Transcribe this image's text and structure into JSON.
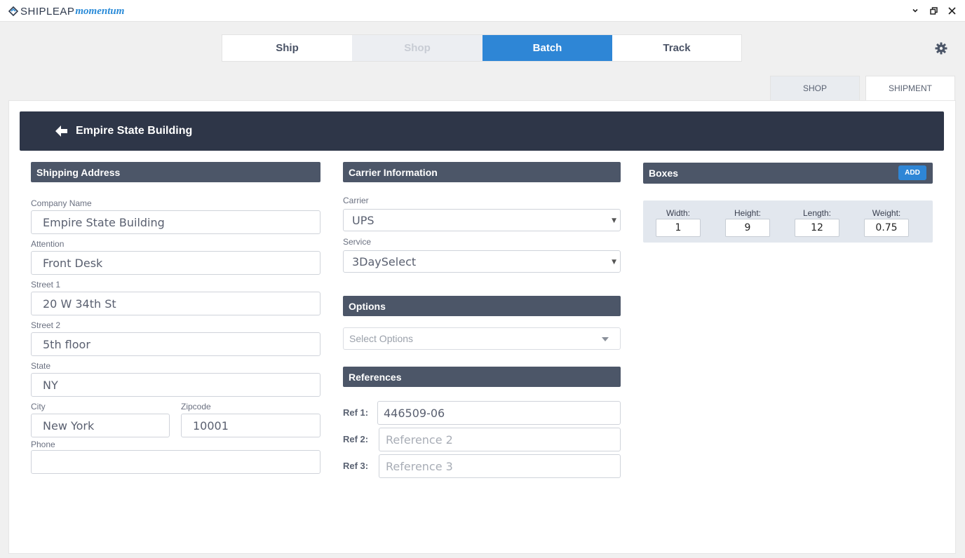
{
  "app": {
    "brand": "SHIPLEAP",
    "brand_sub": "momentum"
  },
  "nav": {
    "tabs": [
      {
        "label": "Ship"
      },
      {
        "label": "Shop"
      },
      {
        "label": "Batch"
      },
      {
        "label": "Track"
      }
    ],
    "active": "Batch"
  },
  "subtabs": [
    "SHOP",
    "SHIPMENT"
  ],
  "header": {
    "title": "Empire State Building"
  },
  "shipping_address": {
    "title": "Shipping Address",
    "company_name": {
      "label": "Company Name",
      "value": "Empire State Building"
    },
    "attention": {
      "label": "Attention",
      "value": "Front Desk"
    },
    "street1": {
      "label": "Street 1",
      "value": "20 W 34th St"
    },
    "street2": {
      "label": "Street 2",
      "value": "5th floor"
    },
    "state": {
      "label": "State",
      "value": "NY"
    },
    "city": {
      "label": "City",
      "value": "New York"
    },
    "zipcode": {
      "label": "Zipcode",
      "value": "10001"
    },
    "phone": {
      "label": "Phone",
      "value": ""
    }
  },
  "carrier": {
    "title": "Carrier Information",
    "carrier_label": "Carrier",
    "carrier_value": "UPS",
    "service_label": "Service",
    "service_value": "3DaySelect"
  },
  "options": {
    "title": "Options",
    "placeholder": "Select Options"
  },
  "references": {
    "title": "References",
    "items": [
      {
        "label": "Ref 1:",
        "value": "446509-06",
        "placeholder": ""
      },
      {
        "label": "Ref 2:",
        "value": "",
        "placeholder": "Reference 2"
      },
      {
        "label": "Ref 3:",
        "value": "",
        "placeholder": "Reference 3"
      }
    ]
  },
  "boxes": {
    "title": "Boxes",
    "add_label": "ADD",
    "width": {
      "label": "Width:",
      "value": "1"
    },
    "height": {
      "label": "Height:",
      "value": "9"
    },
    "length": {
      "label": "Length:",
      "value": "12"
    },
    "weight": {
      "label": "Weight:",
      "value": "0.75"
    }
  },
  "colors": {
    "accent": "#2e86d6",
    "header_dark": "#2e3648",
    "section_head": "#4c5668"
  }
}
